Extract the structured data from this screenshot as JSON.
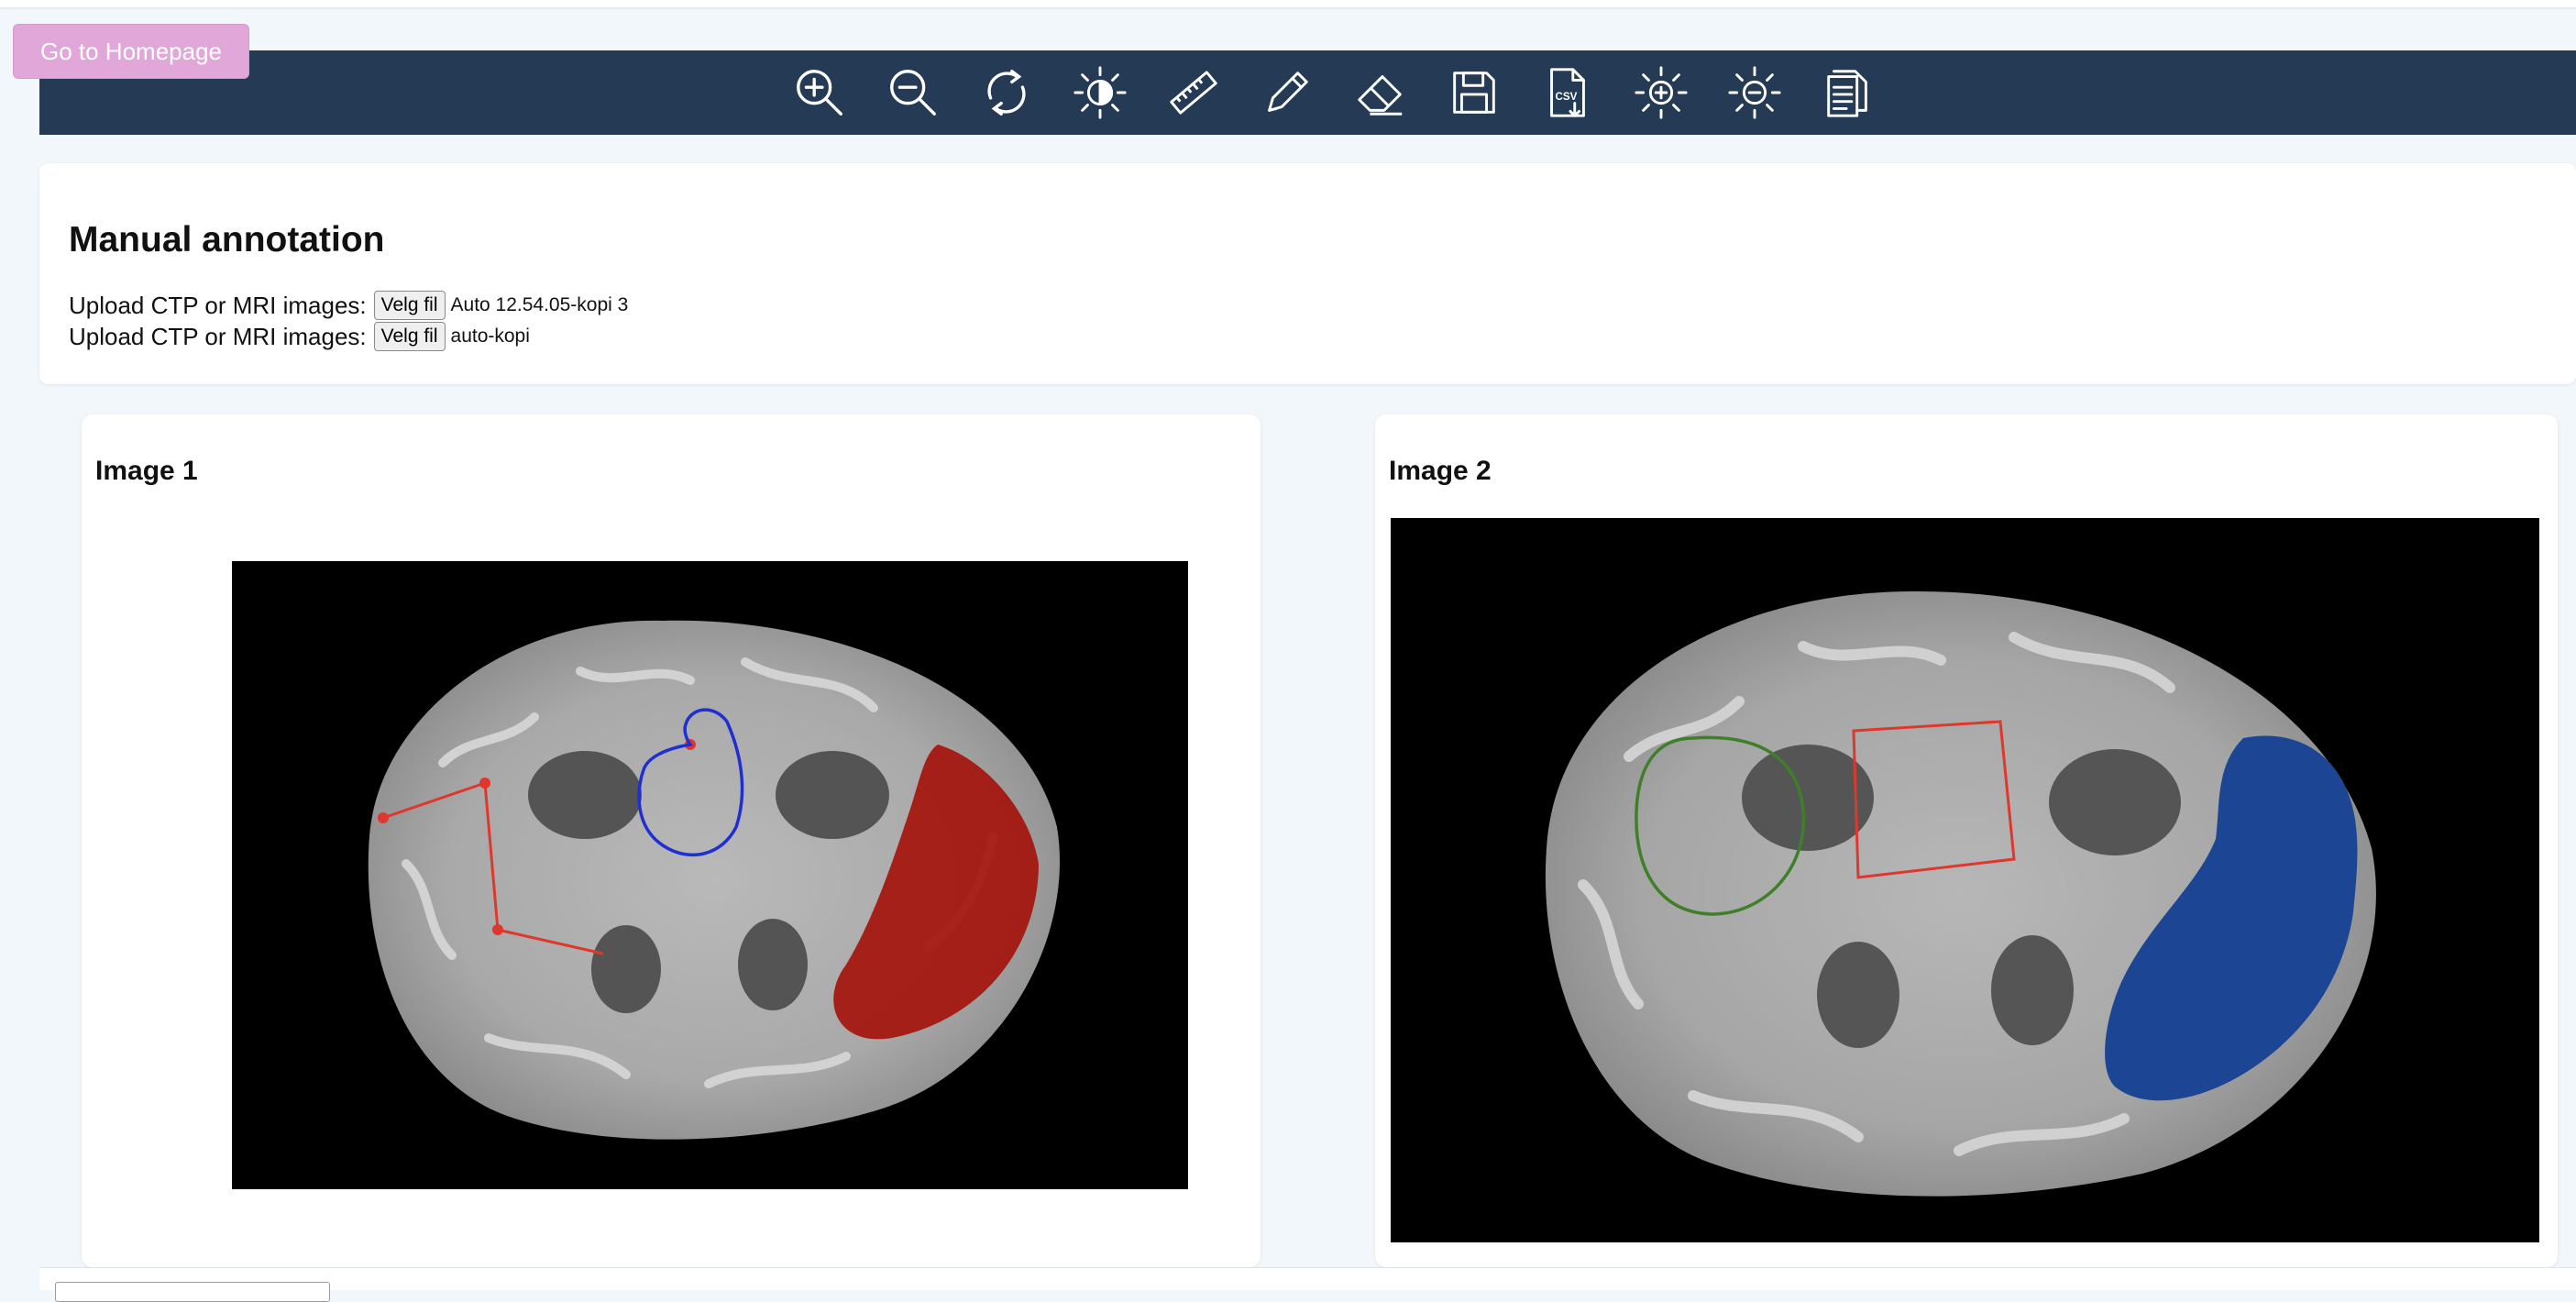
{
  "home_button": "Go to Homepage",
  "toolbar": {
    "icons": [
      "zoom-in-icon",
      "zoom-out-icon",
      "rotate-icon",
      "contrast-icon",
      "ruler-icon",
      "pen-icon",
      "eraser-icon",
      "save-icon",
      "csv-export-icon",
      "brightness-increase-icon",
      "brightness-decrease-icon",
      "copy-document-icon"
    ],
    "colors": {
      "bar": "#243a55",
      "icon": "#ffffff"
    }
  },
  "annotation": {
    "title": "Manual annotation",
    "uploads": [
      {
        "label": "Upload CTP or MRI images:",
        "button": "Velg fil",
        "file": "Auto 12.54.05-kopi 3"
      },
      {
        "label": "Upload CTP or MRI images:",
        "button": "Velg fil",
        "file": "auto-kopi"
      }
    ]
  },
  "images": [
    {
      "title": "Image 1"
    },
    {
      "title": "Image 2"
    }
  ],
  "colors": {
    "home_button": "#e0a7d8",
    "annotation_red": "#e0372c",
    "annotation_blue": "#1f2fd0",
    "annotation_green": "#3f7f2a",
    "mask_blue": "#1c4694",
    "lesion_red": "#a3140c"
  }
}
